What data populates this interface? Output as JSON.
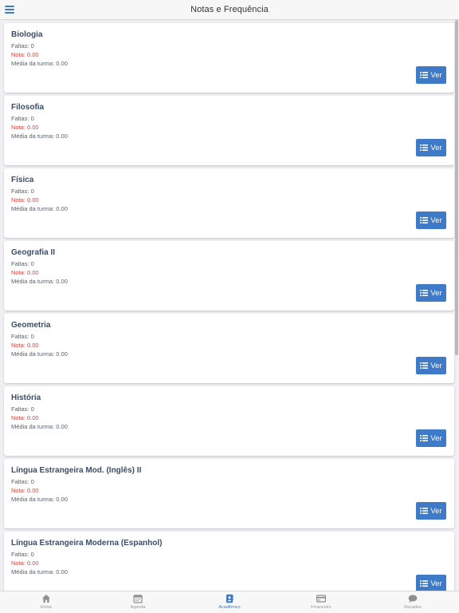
{
  "header": {
    "title": "Notas e Frequência"
  },
  "labels": {
    "faltas": "Faltas:",
    "nota": "Nota:",
    "media": "Média da turma:",
    "ver": "Ver"
  },
  "colors": {
    "accent": "#3f7ac8",
    "nota": "#e0413c",
    "title": "#3b4d66"
  },
  "subjects": [
    {
      "name": "Biologia",
      "faltas": "Faltas: 0",
      "nota": "Nota: 0.00",
      "media": "Média da turma: 0.00"
    },
    {
      "name": "Filosofia",
      "faltas": "Faltas: 0",
      "nota": "Nota: 0.00",
      "media": "Média da turma: 0.00"
    },
    {
      "name": "Física",
      "faltas": "Faltas: 0",
      "nota": "Nota: 0.00",
      "media": "Média da turma: 0.00"
    },
    {
      "name": "Geografia II",
      "faltas": "Faltas: 0",
      "nota": "Nota: 0.00",
      "media": "Média da turma: 0.00"
    },
    {
      "name": "Geometria",
      "faltas": "Faltas: 0",
      "nota": "Nota: 0.00",
      "media": "Média da turma: 0.00"
    },
    {
      "name": "História",
      "faltas": "Faltas: 0",
      "nota": "Nota: 0.00",
      "media": "Média da turma: 0.00"
    },
    {
      "name": "Língua Estrangeira Mod. (Inglês) II",
      "faltas": "Faltas: 0",
      "nota": "Nota: 0.00",
      "media": "Média da turma: 0.00"
    },
    {
      "name": "Língua Estrangeira Moderna (Espanhol)",
      "faltas": "Faltas: 0",
      "nota": "Nota: 0.00",
      "media": "Média da turma: 0.00"
    }
  ],
  "tabbar": {
    "items": [
      {
        "label": "Home",
        "icon": "home-icon"
      },
      {
        "label": "Agenda",
        "icon": "calendar-icon"
      },
      {
        "label": "Acadêmico",
        "icon": "book-icon",
        "active": true
      },
      {
        "label": "Financeiro",
        "icon": "credit-card-icon"
      },
      {
        "label": "Recados",
        "icon": "chat-icon"
      }
    ]
  }
}
